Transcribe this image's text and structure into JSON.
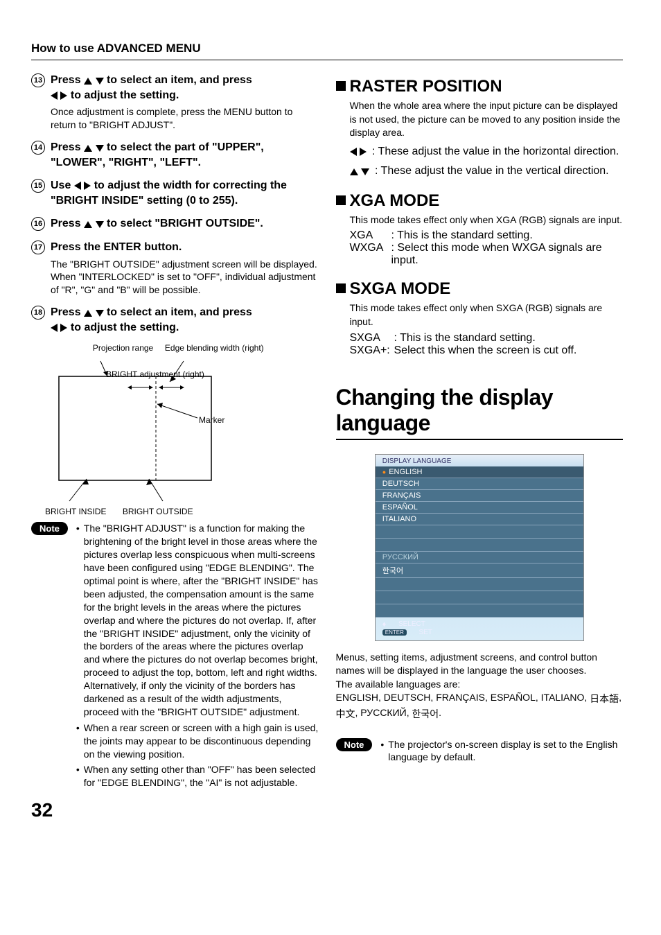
{
  "sectionTitle": "How to use ADVANCED MENU",
  "left": {
    "step13": {
      "num": "13",
      "head_a": "Press",
      "head_b": "to select an item, and press",
      "head_c": "to adjust the setting.",
      "body": "Once adjustment is complete, press the MENU button to return to \"BRIGHT ADJUST\"."
    },
    "step14": {
      "num": "14",
      "head_a": "Press",
      "head_b": "to select the part of \"UPPER\", \"LOWER\", \"RIGHT\", \"LEFT\"."
    },
    "step15": {
      "num": "15",
      "head_a": "Use",
      "head_b": "to adjust the width for correcting the \"BRIGHT INSIDE\" setting (0 to 255)."
    },
    "step16": {
      "num": "16",
      "head_a": "Press",
      "head_b": "to select \"BRIGHT OUTSIDE\"."
    },
    "step17": {
      "num": "17",
      "head": "Press the ENTER button.",
      "body": "The \"BRIGHT OUTSIDE\" adjustment screen will be displayed.\nWhen \"INTERLOCKED\" is set to \"OFF\", individual adjustment of \"R\", \"G\" and \"B\" will be possible."
    },
    "step18": {
      "num": "18",
      "head_a": "Press",
      "head_b": "to select an item, and press",
      "head_c": "to adjust the setting."
    },
    "diagram": {
      "projRange": "Projection range",
      "edgeWidth": "Edge blending width (right)",
      "brightAdj": "BRIGHT adjustment (right)",
      "marker": "Marker",
      "brightInside": "BRIGHT INSIDE",
      "brightOutside": "BRIGHT OUTSIDE"
    },
    "noteLabel": "Note",
    "noteBullets": [
      "The \"BRIGHT ADJUST\" is a function for making the brightening of the bright level in those areas where the pictures overlap less conspicuous when multi-screens have been configured using \"EDGE BLENDING\". The optimal point is where, after the \"BRIGHT INSIDE\" has been adjusted, the compensation amount is the same for the bright levels in the areas where the pictures overlap and where the pictures do not overlap. If, after the \"BRIGHT INSIDE\" adjustment, only the vicinity of the borders of the areas where the pictures overlap and where the pictures do not overlap becomes bright, proceed to adjust the top, bottom, left and right widths. Alternatively, if only the vicinity of the borders has darkened as a result of the width adjustments, proceed with the \"BRIGHT OUTSIDE\" adjustment.",
      "When a rear screen or screen with a high gain is used, the joints may appear to be discontinuous depending on the viewing position.",
      "When any setting other than \"OFF\" has been selected for \"EDGE BLENDING\", the \"AI\" is not adjustable."
    ]
  },
  "right": {
    "raster": {
      "title": "RASTER POSITION",
      "body": "When the whole area where the input picture can be displayed is not used, the picture can be moved to any position inside the display area.",
      "hItem": ": These adjust the value in the horizontal direction.",
      "vItem": ": These adjust the value in the vertical direction."
    },
    "xga": {
      "title": "XGA MODE",
      "body": "This mode takes effect only when XGA (RGB) signals are input.",
      "k1": "XGA",
      "v1": ": This is the standard setting.",
      "k2": "WXGA",
      "v2": ": Select this mode when WXGA signals are input."
    },
    "sxga": {
      "title": "SXGA MODE",
      "body": "This mode takes effect only when SXGA (RGB) signals are input.",
      "k1": "SXGA",
      "v1": ": This is the standard setting.",
      "k2": "SXGA+:",
      "v2": " Select this when the screen is cut off."
    },
    "changing": {
      "title": "Changing the display language",
      "osdTitle": "DISPLAY LANGUAGE",
      "osdItems": [
        "ENGLISH",
        "DEUTSCH",
        "FRANÇAIS",
        "ESPAÑOL",
        "ITALIANO"
      ],
      "osdExtra": [
        "РУССКИЙ",
        "한국어"
      ],
      "osdSelect": "SELECT",
      "osdSet": "SET",
      "enterLabel": "ENTER",
      "body1": "Menus, setting items, adjustment screens, and control button names will be displayed in the language the user chooses.",
      "body2": "The available languages are:",
      "body3a": "ENGLISH, DEUTSCH, FRANÇAIS, ESPAÑOL, ITALIANO, ",
      "body3b": "日本語",
      "body3c": ", ",
      "body3d": "中文",
      "body3e": ", РУССКИЙ, ",
      "body3f": "한국어",
      "body3g": ".",
      "noteLabel": "Note",
      "noteText": "The projector's on-screen display is set to the English language by default."
    }
  },
  "pageNumber": "32"
}
